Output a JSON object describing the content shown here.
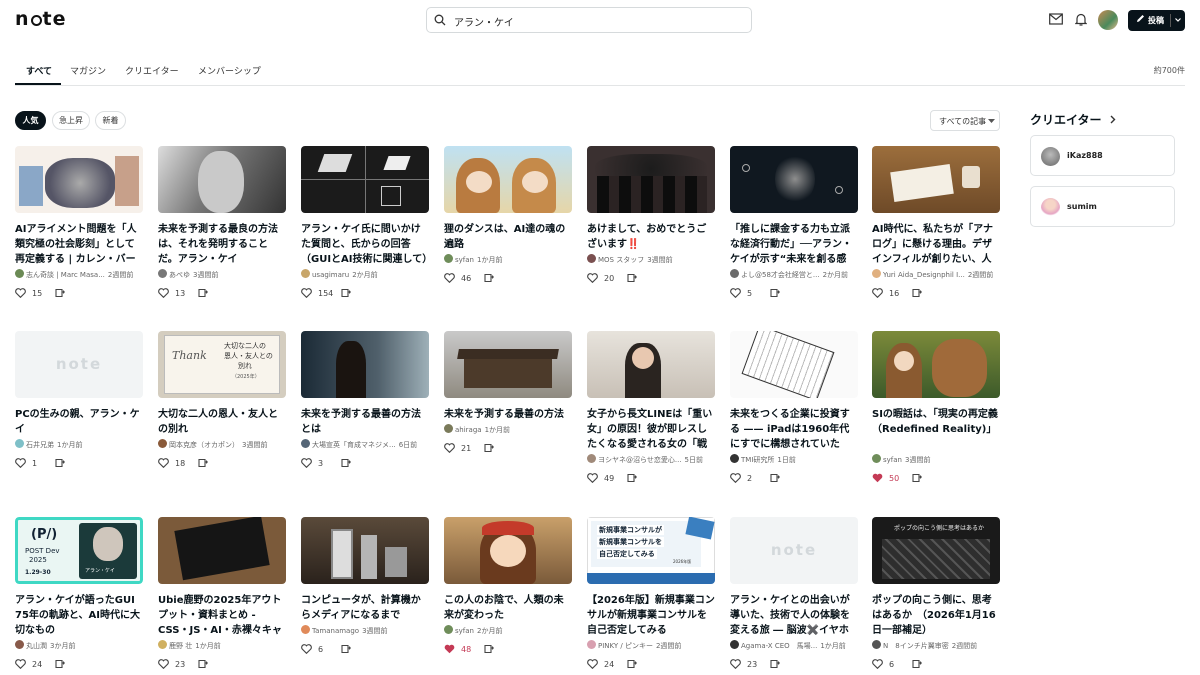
{
  "header": {
    "logo": "note",
    "search_value": "アラン・ケイ",
    "post_label": "投稿"
  },
  "tabs": [
    {
      "label": "すべて",
      "active": true
    },
    {
      "label": "マガジン"
    },
    {
      "label": "クリエイター"
    },
    {
      "label": "メンバーシップ"
    }
  ],
  "result_count": "約700件",
  "filters": [
    "人気",
    "急上昇",
    "新着"
  ],
  "sort_dropdown": "すべての記事",
  "sidebar": {
    "title": "クリエイター",
    "creators": [
      {
        "name": "iKaz888"
      },
      {
        "name": "sumim"
      }
    ]
  },
  "articles": [
    {
      "title": "AIアライメント問題を「人類究極の社会彫刻」として再定義する | カレン・バーク・ル...",
      "author": "志ん奇談 | Marc Masa...",
      "time": "2週間前",
      "likes": "15",
      "liked": false
    },
    {
      "title": "未来を予測する最良の方法は、それを発明することだ。アラン・ケイ",
      "author": "あぺゆ",
      "time": "3週間前",
      "likes": "13",
      "liked": false
    },
    {
      "title": "アラン・ケイ氏に問いかけた質問と、氏からの回答（GUIとAI技術に関連して）",
      "author": "usagimaru",
      "time": "2か月前",
      "likes": "154",
      "liked": false
    },
    {
      "title": "狸のダンスは、AI達の魂の遍路",
      "author": "syfan",
      "time": "1か月前",
      "likes": "46",
      "liked": false
    },
    {
      "title": "あけまして、おめでとうございます‼️",
      "author": "MOS スタッフ",
      "time": "3週間前",
      "likes": "20",
      "liked": false
    },
    {
      "title": "「推しに課金する力も立派な経済行動だ」──アラン・ケイが示す“未来を創る感性”",
      "author": "よし@58才会社経営と...",
      "time": "2か月前",
      "likes": "5",
      "liked": false
    },
    {
      "title": "AI時代に、私たちが「アナログ」に懸ける理由。デザインフィルが創りたい、人生の...",
      "author": "Yuri Aida_Designphil I...",
      "time": "2週間前",
      "likes": "16",
      "liked": false
    },
    {
      "title": "PCの生みの親、アラン・ケイ",
      "author": "石井兄弟",
      "time": "1か月前",
      "likes": "1",
      "liked": false
    },
    {
      "title": "大切な二人の恩人・友人との別れ",
      "author": "岡本克彦（オカポン）",
      "time": "3週間前",
      "likes": "18",
      "liked": false
    },
    {
      "title": "未来を予測する最善の方法とは",
      "author": "大場宣英「育成マネジメ...",
      "time": "6日前",
      "likes": "3",
      "liked": false
    },
    {
      "title": "未来を予測する最善の方法",
      "author": "ahiraga",
      "time": "1か月前",
      "likes": "21",
      "liked": false
    },
    {
      "title": "女子から長文LINEは「重い女」の原因！彼が即レスしたくなる愛される女の「戦略...",
      "author": "ヨシヤネ@沼らせ恋愛心...",
      "time": "5日前",
      "likes": "49",
      "liked": false
    },
    {
      "title": "未来をつくる企業に投資する —— iPadは1960年代にすでに構想されていた",
      "author": "TMI研究所",
      "time": "1日前",
      "likes": "2",
      "liked": false
    },
    {
      "title": "SIの暇話は、「現実の再定義（Redefined Reality)」",
      "author": "syfan",
      "time": "3週間前",
      "likes": "50",
      "liked": true
    },
    {
      "title": "アラン・ケイが語ったGUI 75年の軌跡と、AI時代に大切なもの",
      "author": "丸山潤",
      "time": "3か月前",
      "likes": "24",
      "liked": false
    },
    {
      "title": "Ubie鹿野の2025年アウトプット・資料まとめ - CSS・JS・AI・赤裸々キャリア",
      "author": "鹿野 壮",
      "time": "1か月前",
      "likes": "23",
      "liked": false
    },
    {
      "title": "コンピュータが、計算機からメディアになるまで",
      "author": "Tamanamago",
      "time": "3週間前",
      "likes": "6",
      "liked": false
    },
    {
      "title": "この人のお陰で、人類の未来が変わった",
      "author": "syfan",
      "time": "2か月前",
      "likes": "48",
      "liked": true
    },
    {
      "title": "【2026年版】新規事業コンサルが新規事業コンサルを自己否定してみる",
      "author": "PINKY / ピンキー",
      "time": "2週間前",
      "likes": "24",
      "liked": false
    },
    {
      "title": "アラン・ケイとの出会いが導いた、技術で人の体験を変える旅 ― 脳波✖️イヤホン...",
      "author": "Agama-X CEO　馬場...",
      "time": "1か月前",
      "likes": "23",
      "liked": false
    },
    {
      "title": "ポップの向こう側に、思考はあるか　（2026年1月16日一部補足）",
      "author": "N　8インチ片翼审密",
      "time": "2週間前",
      "likes": "6",
      "liked": false
    }
  ],
  "thumb_texts": {
    "t8": "note",
    "t9a": "大切な二人の",
    "t9b": "恩人・友人との",
    "t9c": "別れ",
    "t9d": "（2025年）",
    "t15a": "POST Dev",
    "t15b": "2025",
    "t15c": "1.29-30",
    "t15d": "アラン・ケイ",
    "t19a": "新規事業コンサルが",
    "t19b": "新規事業コンサルを",
    "t19c": "自己否定してみる",
    "t19d": "2026年版",
    "t20": "note",
    "t21": "ポップの向こう側に思考はあるか"
  },
  "colors": {
    "accent": "#08131a",
    "liked": "#c43a55",
    "border": "#e3e5e6"
  }
}
